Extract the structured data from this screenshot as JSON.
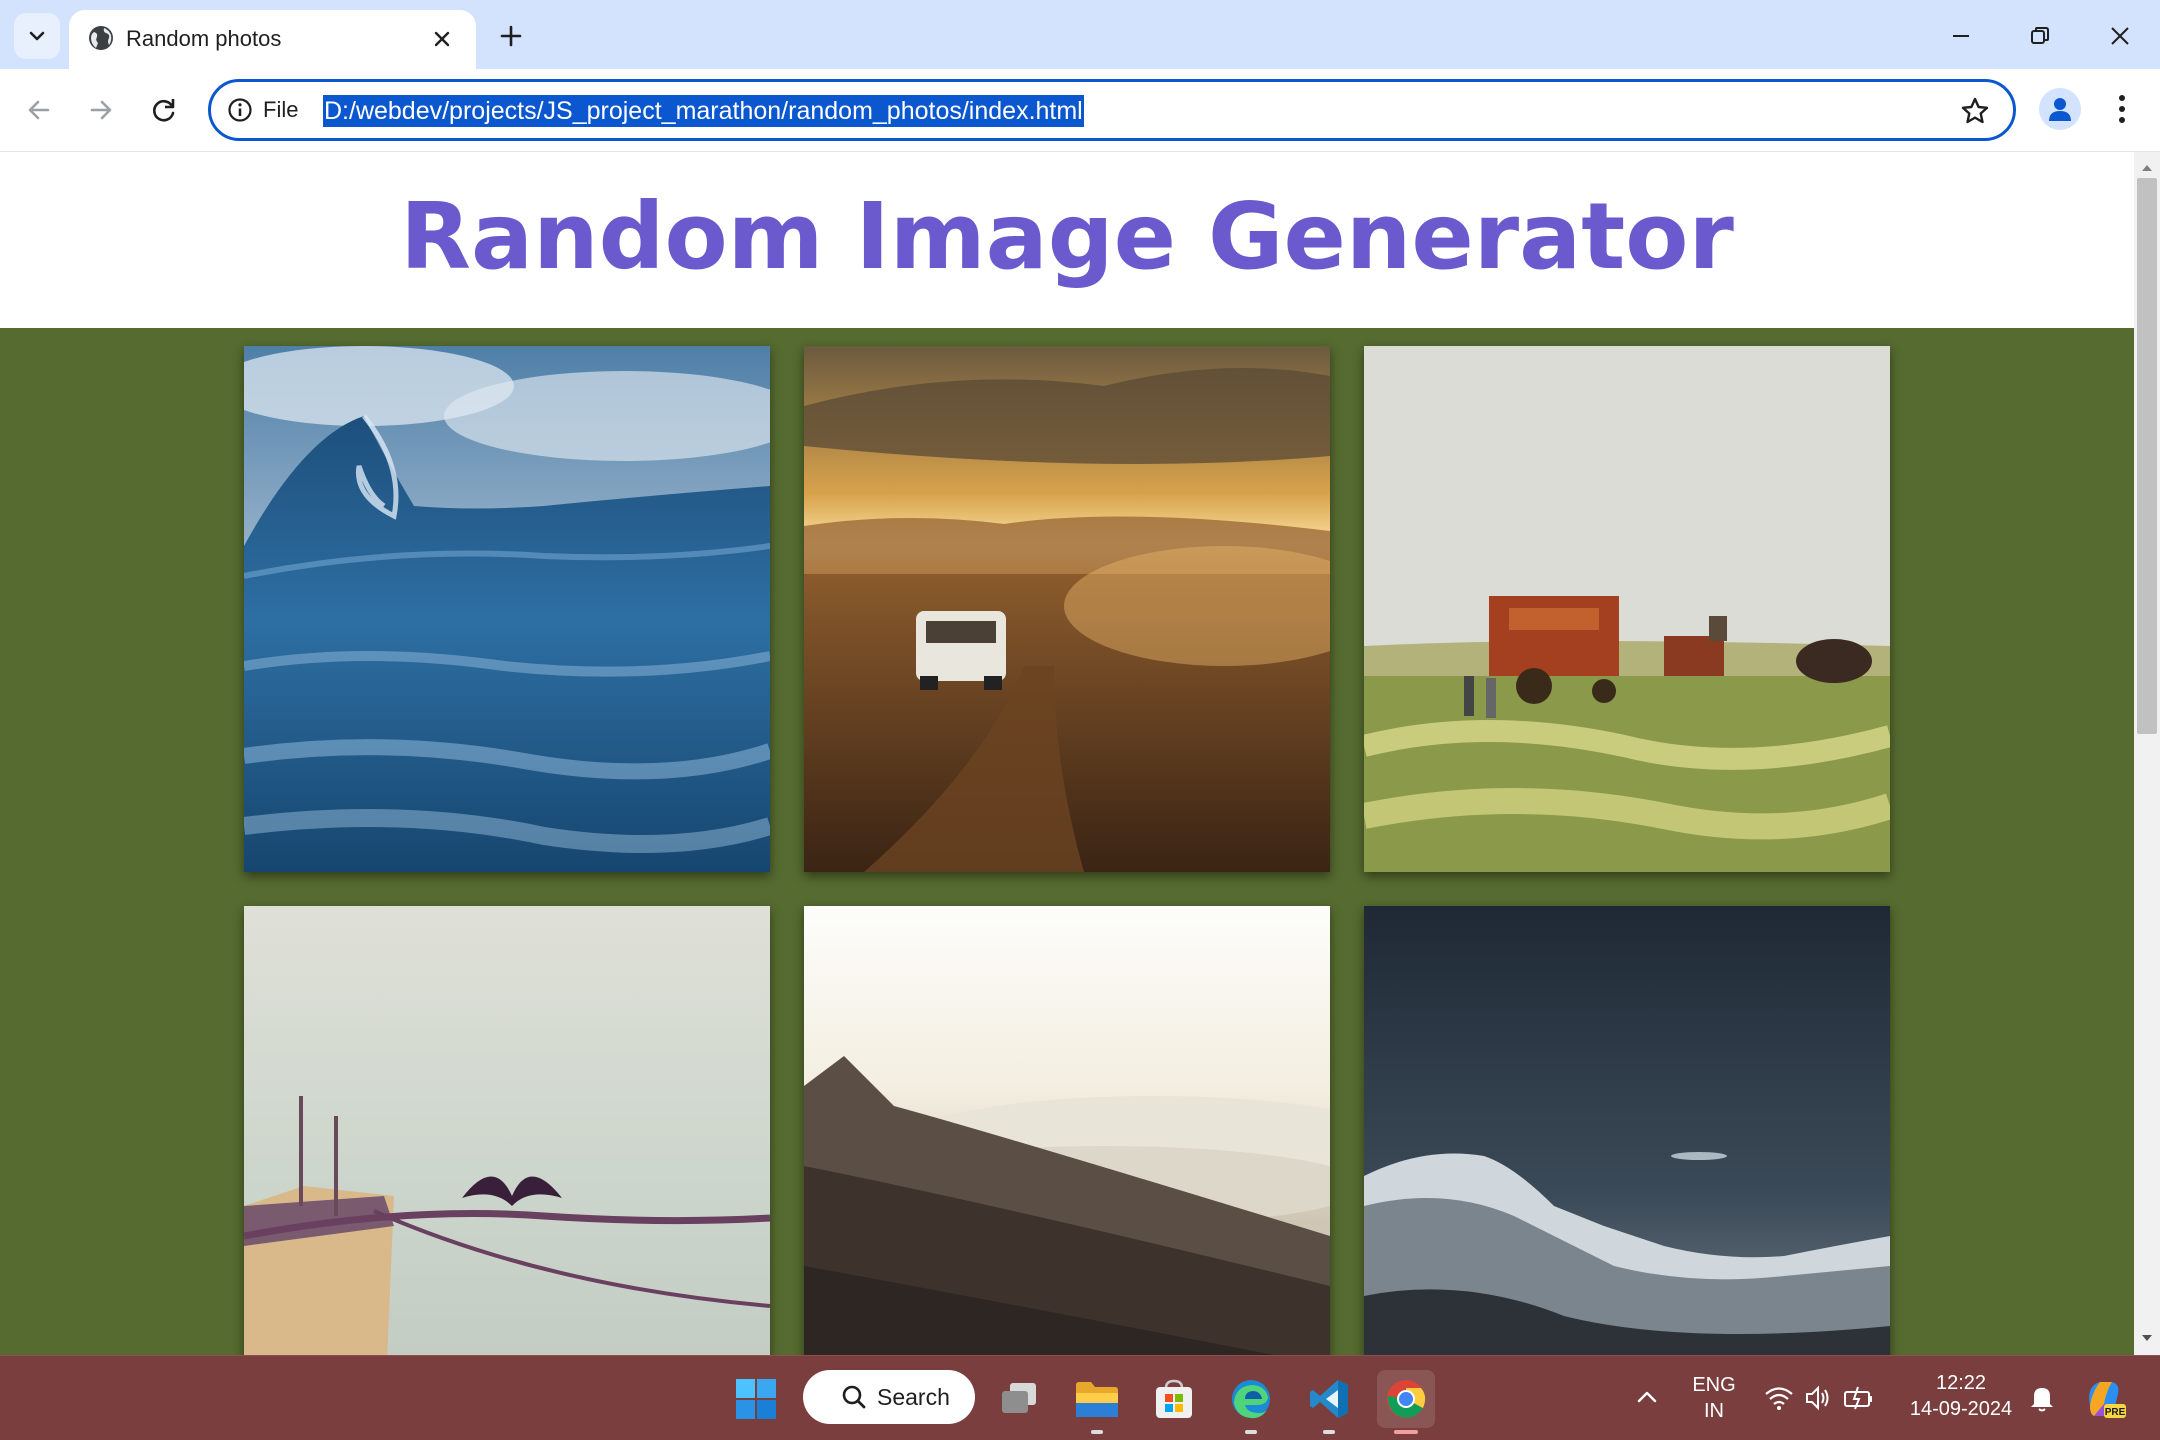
{
  "browser": {
    "tab": {
      "title": "Random photos"
    },
    "address_bar": {
      "security_label": "File",
      "url": "D:/webdev/projects/JS_project_marathon/random_photos/index.html"
    }
  },
  "page": {
    "title": "Random Image Generator",
    "colors": {
      "title": "#6a5acd",
      "gallery_background": "#556b2f"
    },
    "images": [
      {
        "subject": "ocean-wave"
      },
      {
        "subject": "van-desert-sunset"
      },
      {
        "subject": "hay-baler-horses-field"
      },
      {
        "subject": "cormorant-on-rope-lake"
      },
      {
        "subject": "mountain-above-clouds"
      },
      {
        "subject": "snowy-mountain-night"
      }
    ]
  },
  "taskbar": {
    "search_label": "Search",
    "language": {
      "line1": "ENG",
      "line2": "IN"
    },
    "clock": {
      "time": "12:22",
      "date": "14-09-2024"
    },
    "colors": {
      "background": "#7a3e3e"
    }
  }
}
